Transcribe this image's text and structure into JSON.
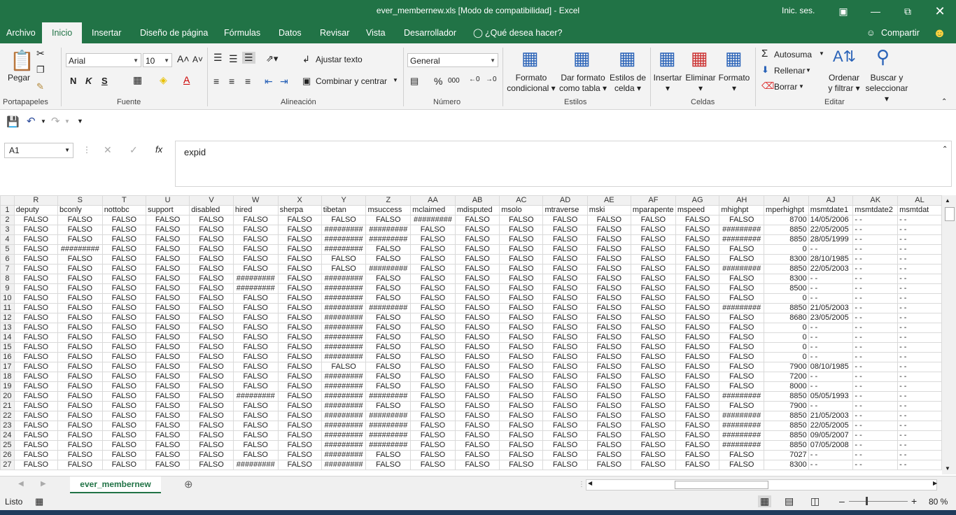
{
  "window": {
    "title": "ever_membernew.xls  [Modo de compatibilidad]  -  Excel",
    "signin": "Inic. ses."
  },
  "tabs": [
    "Archivo",
    "Inicio",
    "Insertar",
    "Diseño de página",
    "Fórmulas",
    "Datos",
    "Revisar",
    "Vista",
    "Desarrollador"
  ],
  "tell_me": "¿Qué desea hacer?",
  "share": "Compartir",
  "ribbon": {
    "paste": "Pegar",
    "groups": [
      "Portapapeles",
      "Fuente",
      "Alineación",
      "Número",
      "Estilos",
      "Celdas",
      "Editar"
    ],
    "font_name": "Arial",
    "font_size": "10",
    "bold": "N",
    "italic": "K",
    "underline": "S",
    "wrap_text": "Ajustar texto",
    "merge_center": "Combinar y centrar",
    "number_format": "General",
    "cond_format_1": "Formato",
    "cond_format_2": "condicional",
    "format_table_1": "Dar formato",
    "format_table_2": "como tabla",
    "cell_styles_1": "Estilos de",
    "cell_styles_2": "celda",
    "insert": "Insertar",
    "delete": "Eliminar",
    "format": "Formato",
    "autosum": "Autosuma",
    "fill": "Rellenar",
    "clear": "Borrar",
    "sort_1": "Ordenar",
    "sort_2": "y filtrar",
    "find_1": "Buscar y",
    "find_2": "seleccionar"
  },
  "formula_bar": {
    "name_box": "A1",
    "formula": "expid"
  },
  "sheet": {
    "columns": [
      "R",
      "S",
      "T",
      "U",
      "V",
      "W",
      "X",
      "Y",
      "Z",
      "AA",
      "AB",
      "AC",
      "AD",
      "AE",
      "AF",
      "AG",
      "AH",
      "AI",
      "AJ",
      "AK",
      "AL"
    ],
    "headers": [
      "deputy",
      "bconly",
      "nottobc",
      "support",
      "disabled",
      "hired",
      "sherpa",
      "tibetan",
      "msuccess",
      "mclaimed",
      "mdisputed",
      "msolo",
      "mtraverse",
      "mski",
      "mparapente",
      "mspeed",
      "mhighpt",
      "mperhighpt",
      "msmtdate1",
      "msmtdate2",
      "msmtdat"
    ],
    "rows": [
      [
        "2",
        "FALSO",
        "FALSO",
        "FALSO",
        "FALSO",
        "FALSO",
        "FALSO",
        "FALSO",
        "FALSO",
        "FALSO",
        "#########",
        "FALSO",
        "FALSO",
        "FALSO",
        "FALSO",
        "FALSO",
        "FALSO",
        "FALSO",
        "8700",
        "14/05/2006",
        "-  -",
        "-  -"
      ],
      [
        "3",
        "FALSO",
        "FALSO",
        "FALSO",
        "FALSO",
        "FALSO",
        "FALSO",
        "FALSO",
        "#########",
        "#########",
        "FALSO",
        "FALSO",
        "FALSO",
        "FALSO",
        "FALSO",
        "FALSO",
        "FALSO",
        "#########",
        "8850",
        "22/05/2005",
        "-  -",
        "-  -"
      ],
      [
        "4",
        "FALSO",
        "FALSO",
        "FALSO",
        "FALSO",
        "FALSO",
        "FALSO",
        "FALSO",
        "#########",
        "#########",
        "FALSO",
        "FALSO",
        "FALSO",
        "FALSO",
        "FALSO",
        "FALSO",
        "FALSO",
        "#########",
        "8850",
        "28/05/1999",
        "-  -",
        "-  -"
      ],
      [
        "5",
        "FALSO",
        "#########",
        "FALSO",
        "FALSO",
        "FALSO",
        "FALSO",
        "FALSO",
        "#########",
        "FALSO",
        "FALSO",
        "FALSO",
        "FALSO",
        "FALSO",
        "FALSO",
        "FALSO",
        "FALSO",
        "FALSO",
        "0",
        "-  -",
        "-  -",
        "-  -"
      ],
      [
        "6",
        "FALSO",
        "FALSO",
        "FALSO",
        "FALSO",
        "FALSO",
        "FALSO",
        "FALSO",
        "FALSO",
        "FALSO",
        "FALSO",
        "FALSO",
        "FALSO",
        "FALSO",
        "FALSO",
        "FALSO",
        "FALSO",
        "FALSO",
        "8300",
        "28/10/1985",
        "-  -",
        "-  -"
      ],
      [
        "7",
        "FALSO",
        "FALSO",
        "FALSO",
        "FALSO",
        "FALSO",
        "FALSO",
        "FALSO",
        "FALSO",
        "#########",
        "FALSO",
        "FALSO",
        "FALSO",
        "FALSO",
        "FALSO",
        "FALSO",
        "FALSO",
        "#########",
        "8850",
        "22/05/2003",
        "-  -",
        "-  -"
      ],
      [
        "8",
        "FALSO",
        "FALSO",
        "FALSO",
        "FALSO",
        "FALSO",
        "#########",
        "FALSO",
        "#########",
        "FALSO",
        "FALSO",
        "FALSO",
        "FALSO",
        "FALSO",
        "FALSO",
        "FALSO",
        "FALSO",
        "FALSO",
        "8300",
        "-  -",
        "-  -",
        "-  -"
      ],
      [
        "9",
        "FALSO",
        "FALSO",
        "FALSO",
        "FALSO",
        "FALSO",
        "#########",
        "FALSO",
        "#########",
        "FALSO",
        "FALSO",
        "FALSO",
        "FALSO",
        "FALSO",
        "FALSO",
        "FALSO",
        "FALSO",
        "FALSO",
        "8500",
        "-  -",
        "-  -",
        "-  -"
      ],
      [
        "10",
        "FALSO",
        "FALSO",
        "FALSO",
        "FALSO",
        "FALSO",
        "FALSO",
        "FALSO",
        "#########",
        "FALSO",
        "FALSO",
        "FALSO",
        "FALSO",
        "FALSO",
        "FALSO",
        "FALSO",
        "FALSO",
        "FALSO",
        "0",
        "-  -",
        "-  -",
        "-  -"
      ],
      [
        "11",
        "FALSO",
        "FALSO",
        "FALSO",
        "FALSO",
        "FALSO",
        "FALSO",
        "FALSO",
        "#########",
        "#########",
        "FALSO",
        "FALSO",
        "FALSO",
        "FALSO",
        "FALSO",
        "FALSO",
        "FALSO",
        "#########",
        "8850",
        "21/05/2003",
        "-  -",
        "-  -"
      ],
      [
        "12",
        "FALSO",
        "FALSO",
        "FALSO",
        "FALSO",
        "FALSO",
        "FALSO",
        "FALSO",
        "#########",
        "FALSO",
        "FALSO",
        "FALSO",
        "FALSO",
        "FALSO",
        "FALSO",
        "FALSO",
        "FALSO",
        "FALSO",
        "8680",
        "23/05/2005",
        "-  -",
        "-  -"
      ],
      [
        "13",
        "FALSO",
        "FALSO",
        "FALSO",
        "FALSO",
        "FALSO",
        "FALSO",
        "FALSO",
        "#########",
        "FALSO",
        "FALSO",
        "FALSO",
        "FALSO",
        "FALSO",
        "FALSO",
        "FALSO",
        "FALSO",
        "FALSO",
        "0",
        "-  -",
        "-  -",
        "-  -"
      ],
      [
        "14",
        "FALSO",
        "FALSO",
        "FALSO",
        "FALSO",
        "FALSO",
        "FALSO",
        "FALSO",
        "#########",
        "FALSO",
        "FALSO",
        "FALSO",
        "FALSO",
        "FALSO",
        "FALSO",
        "FALSO",
        "FALSO",
        "FALSO",
        "0",
        "-  -",
        "-  -",
        "-  -"
      ],
      [
        "15",
        "FALSO",
        "FALSO",
        "FALSO",
        "FALSO",
        "FALSO",
        "FALSO",
        "FALSO",
        "#########",
        "FALSO",
        "FALSO",
        "FALSO",
        "FALSO",
        "FALSO",
        "FALSO",
        "FALSO",
        "FALSO",
        "FALSO",
        "0",
        "-  -",
        "-  -",
        "-  -"
      ],
      [
        "16",
        "FALSO",
        "FALSO",
        "FALSO",
        "FALSO",
        "FALSO",
        "FALSO",
        "FALSO",
        "#########",
        "FALSO",
        "FALSO",
        "FALSO",
        "FALSO",
        "FALSO",
        "FALSO",
        "FALSO",
        "FALSO",
        "FALSO",
        "0",
        "-  -",
        "-  -",
        "-  -"
      ],
      [
        "17",
        "FALSO",
        "FALSO",
        "FALSO",
        "FALSO",
        "FALSO",
        "FALSO",
        "FALSO",
        "FALSO",
        "FALSO",
        "FALSO",
        "FALSO",
        "FALSO",
        "FALSO",
        "FALSO",
        "FALSO",
        "FALSO",
        "FALSO",
        "7900",
        "08/10/1985",
        "-  -",
        "-  -"
      ],
      [
        "18",
        "FALSO",
        "FALSO",
        "FALSO",
        "FALSO",
        "FALSO",
        "FALSO",
        "FALSO",
        "#########",
        "FALSO",
        "FALSO",
        "FALSO",
        "FALSO",
        "FALSO",
        "FALSO",
        "FALSO",
        "FALSO",
        "FALSO",
        "7200",
        "-  -",
        "-  -",
        "-  -"
      ],
      [
        "19",
        "FALSO",
        "FALSO",
        "FALSO",
        "FALSO",
        "FALSO",
        "FALSO",
        "FALSO",
        "#########",
        "FALSO",
        "FALSO",
        "FALSO",
        "FALSO",
        "FALSO",
        "FALSO",
        "FALSO",
        "FALSO",
        "FALSO",
        "8000",
        "-  -",
        "-  -",
        "-  -"
      ],
      [
        "20",
        "FALSO",
        "FALSO",
        "FALSO",
        "FALSO",
        "FALSO",
        "#########",
        "FALSO",
        "#########",
        "#########",
        "FALSO",
        "FALSO",
        "FALSO",
        "FALSO",
        "FALSO",
        "FALSO",
        "FALSO",
        "#########",
        "8850",
        "05/05/1993",
        "-  -",
        "-  -"
      ],
      [
        "21",
        "FALSO",
        "FALSO",
        "FALSO",
        "FALSO",
        "FALSO",
        "FALSO",
        "FALSO",
        "#########",
        "FALSO",
        "FALSO",
        "FALSO",
        "FALSO",
        "FALSO",
        "FALSO",
        "FALSO",
        "FALSO",
        "FALSO",
        "7900",
        "-  -",
        "-  -",
        "-  -"
      ],
      [
        "22",
        "FALSO",
        "FALSO",
        "FALSO",
        "FALSO",
        "FALSO",
        "FALSO",
        "FALSO",
        "#########",
        "#########",
        "FALSO",
        "FALSO",
        "FALSO",
        "FALSO",
        "FALSO",
        "FALSO",
        "FALSO",
        "#########",
        "8850",
        "21/05/2003",
        "-  -",
        "-  -"
      ],
      [
        "23",
        "FALSO",
        "FALSO",
        "FALSO",
        "FALSO",
        "FALSO",
        "FALSO",
        "FALSO",
        "#########",
        "#########",
        "FALSO",
        "FALSO",
        "FALSO",
        "FALSO",
        "FALSO",
        "FALSO",
        "FALSO",
        "#########",
        "8850",
        "22/05/2005",
        "-  -",
        "-  -"
      ],
      [
        "24",
        "FALSO",
        "FALSO",
        "FALSO",
        "FALSO",
        "FALSO",
        "FALSO",
        "FALSO",
        "#########",
        "#########",
        "FALSO",
        "FALSO",
        "FALSO",
        "FALSO",
        "FALSO",
        "FALSO",
        "FALSO",
        "#########",
        "8850",
        "09/05/2007",
        "-  -",
        "-  -"
      ],
      [
        "25",
        "FALSO",
        "FALSO",
        "FALSO",
        "FALSO",
        "FALSO",
        "FALSO",
        "FALSO",
        "#########",
        "#########",
        "FALSO",
        "FALSO",
        "FALSO",
        "FALSO",
        "FALSO",
        "FALSO",
        "FALSO",
        "#########",
        "8850",
        "07/05/2008",
        "-  -",
        "-  -"
      ],
      [
        "26",
        "FALSO",
        "FALSO",
        "FALSO",
        "FALSO",
        "FALSO",
        "FALSO",
        "FALSO",
        "#########",
        "FALSO",
        "FALSO",
        "FALSO",
        "FALSO",
        "FALSO",
        "FALSO",
        "FALSO",
        "FALSO",
        "FALSO",
        "7027",
        "-  -",
        "-  -",
        "-  -"
      ],
      [
        "27",
        "FALSO",
        "FALSO",
        "FALSO",
        "FALSO",
        "FALSO",
        "#########",
        "FALSO",
        "#########",
        "FALSO",
        "FALSO",
        "FALSO",
        "FALSO",
        "FALSO",
        "FALSO",
        "FALSO",
        "FALSO",
        "FALSO",
        "8300",
        "-  -",
        "-  -",
        "-  -"
      ]
    ]
  },
  "sheet_tab": "ever_membernew",
  "status": {
    "ready": "Listo",
    "zoom": "80 %"
  },
  "colors": {
    "brand": "#217346",
    "ribbon_bg": "#f3f3f3"
  }
}
